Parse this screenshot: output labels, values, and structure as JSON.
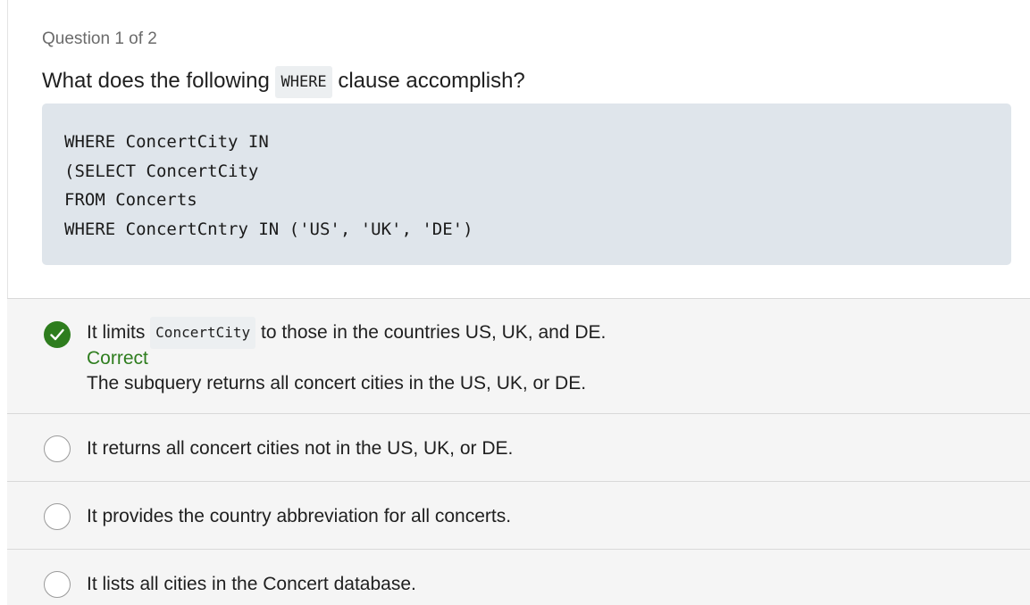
{
  "quiz": {
    "counter": "Question 1 of 2",
    "question": {
      "before": "What does the following",
      "code": "WHERE",
      "after": "clause accomplish?"
    },
    "code_block": [
      "WHERE ConcertCity IN",
      "(SELECT ConcertCity",
      "FROM Concerts",
      "WHERE ConcertCntry IN ('US', 'UK', 'DE')"
    ],
    "answers": [
      {
        "before": "It limits",
        "code": "ConcertCity",
        "after": "to those in the countries US, UK, and DE.",
        "selected": true,
        "status": "Correct",
        "explanation": "The subquery returns all concert cities in the US, UK, or DE."
      },
      {
        "text": "It returns all concert cities not in the US, UK, or DE.",
        "selected": false
      },
      {
        "text": "It provides the country abbreviation for all concerts.",
        "selected": false
      },
      {
        "text": "It lists all cities in the Concert database.",
        "selected": false
      }
    ]
  },
  "colors": {
    "correct": "#2e7d1e",
    "code_block_bg": "#dfe5eb",
    "answers_bg": "#f5f5f5"
  },
  "icons": {
    "selected": "checkmark-icon"
  }
}
